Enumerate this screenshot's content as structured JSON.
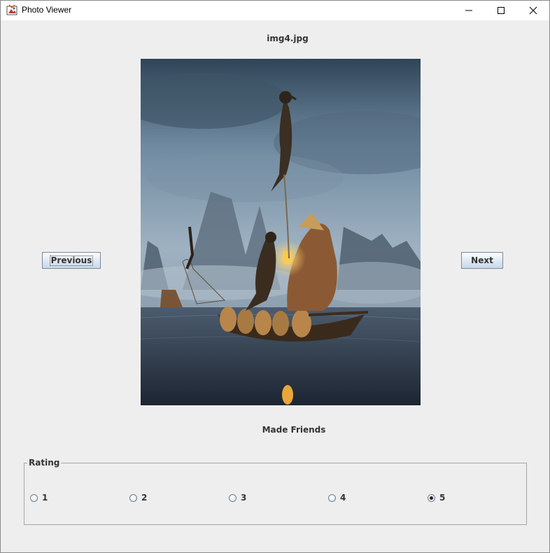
{
  "window": {
    "title": "Photo Viewer",
    "app_icon": "java-app-icon"
  },
  "viewer": {
    "filename": "img4.jpg",
    "caption": "Made Friends",
    "previous_label": "Previous",
    "next_label": "Next",
    "photo_description_icon": "photo-image"
  },
  "rating": {
    "title": "Rating",
    "options": [
      "1",
      "2",
      "3",
      "4",
      "5"
    ],
    "selected": "5"
  },
  "colors": {
    "background": "#eeeeee",
    "button_gradient_bottom": "#c8d8e9"
  }
}
